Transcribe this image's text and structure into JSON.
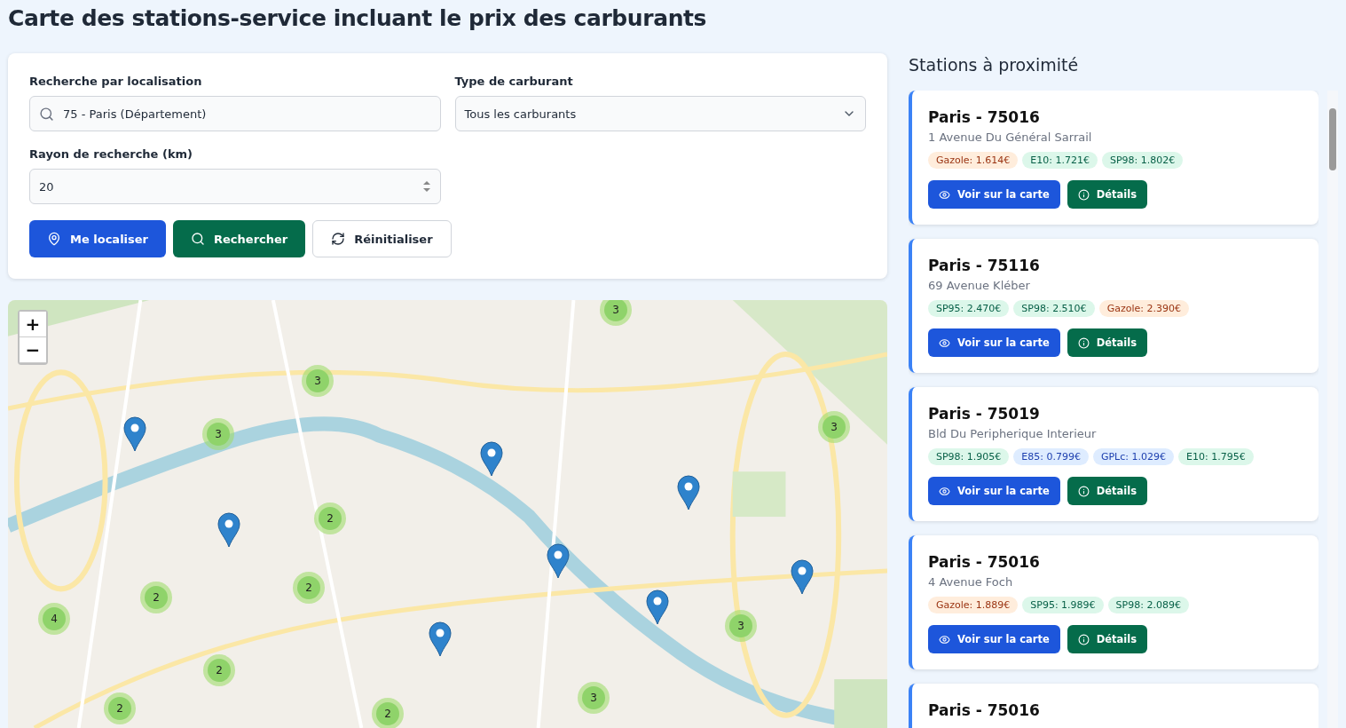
{
  "title": "Carte des stations-service incluant le prix des carburants",
  "search": {
    "location_label": "Recherche par localisation",
    "location_value": "75 - Paris (Département)",
    "fuel_label": "Type de carburant",
    "fuel_value": "Tous les carburants",
    "radius_label": "Rayon de recherche (km)",
    "radius_value": "20",
    "buttons": [
      {
        "kind": "locate",
        "label": "Me localiser"
      },
      {
        "kind": "search",
        "label": "Rechercher"
      },
      {
        "kind": "reset",
        "label": "Réinitialiser"
      }
    ]
  },
  "map": {
    "kind": "picture",
    "zoom": [
      "+",
      "−"
    ],
    "clusters": [
      {
        "count": "3"
      },
      {
        "count": "3"
      },
      {
        "count": "3"
      },
      {
        "count": "3"
      },
      {
        "count": "2"
      },
      {
        "count": "2"
      },
      {
        "count": "2"
      },
      {
        "count": "4"
      },
      {
        "count": "2"
      },
      {
        "count": "3"
      },
      {
        "count": "3"
      },
      {
        "count": "2"
      },
      {
        "count": "2"
      }
    ]
  },
  "nearby": {
    "heading": "Stations à proximité",
    "stations": [
      {
        "name": "Paris - 75016",
        "address": "1 Avenue Du Général Sarrail",
        "prices": [
          {
            "kind": "diesel",
            "text": "Gazole: 1.614€"
          },
          {
            "kind": "petrol",
            "text": "E10: 1.721€"
          },
          {
            "kind": "petrol",
            "text": "SP98: 1.802€"
          }
        ],
        "map_button": "Voir sur la carte",
        "details_button": "Détails"
      },
      {
        "name": "Paris - 75116",
        "address": "69 Avenue Kléber",
        "prices": [
          {
            "kind": "petrol",
            "text": "SP95: 2.470€"
          },
          {
            "kind": "petrol",
            "text": "SP98: 2.510€"
          },
          {
            "kind": "diesel",
            "text": "Gazole: 2.390€"
          }
        ],
        "map_button": "Voir sur la carte",
        "details_button": "Détails"
      },
      {
        "name": "Paris - 75019",
        "address": "Bld Du Peripherique Interieur",
        "prices": [
          {
            "kind": "petrol",
            "text": "SP98: 1.905€"
          },
          {
            "kind": "alternative",
            "text": "E85: 0.799€"
          },
          {
            "kind": "alternative",
            "text": "GPLc: 1.029€"
          },
          {
            "kind": "petrol",
            "text": "E10: 1.795€"
          }
        ],
        "map_button": "Voir sur la carte",
        "details_button": "Détails"
      },
      {
        "name": "Paris - 75016",
        "address": "4 Avenue Foch",
        "prices": [
          {
            "kind": "diesel",
            "text": "Gazole: 1.889€"
          },
          {
            "kind": "petrol",
            "text": "SP95: 1.989€"
          },
          {
            "kind": "petrol",
            "text": "SP98: 2.089€"
          }
        ],
        "map_button": "Voir sur la carte",
        "details_button": "Détails"
      },
      {
        "name": "Paris - 75016"
      }
    ]
  }
}
